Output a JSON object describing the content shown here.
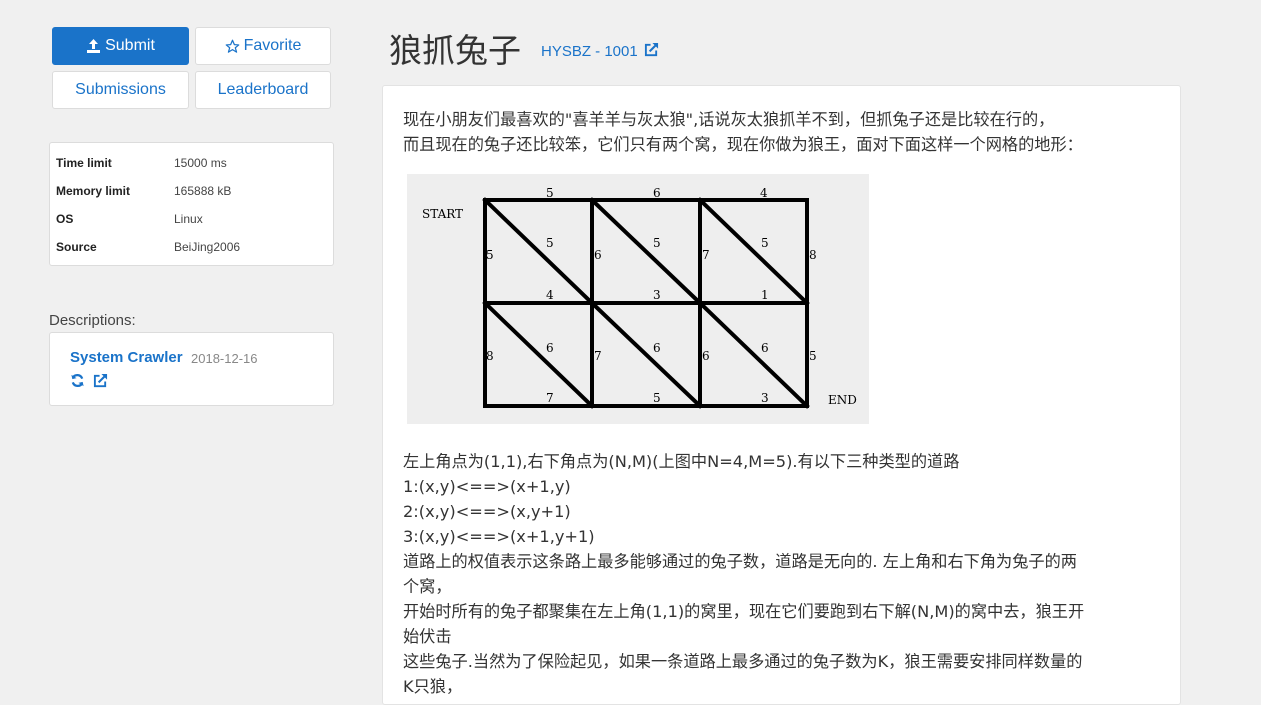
{
  "sidebar": {
    "buttons": {
      "submit": "Submit",
      "favorite": "Favorite",
      "submissions": "Submissions",
      "leaderboard": "Leaderboard"
    },
    "info": [
      {
        "key": "Time limit",
        "value": "15000 ms"
      },
      {
        "key": "Memory limit",
        "value": "165888 kB"
      },
      {
        "key": "OS",
        "value": "Linux"
      },
      {
        "key": "Source",
        "value": "BeiJing2006"
      }
    ],
    "descriptions_label": "Descriptions:",
    "description": {
      "author": "System Crawler",
      "date": "2018-12-16"
    }
  },
  "problem": {
    "title": "狼抓兔子",
    "link": "HYSBZ - 1001",
    "intro_lines": [
      "现在小朋友们最喜欢的\"喜羊羊与灰太狼\",话说灰太狼抓羊不到，但抓兔子还是比较在行的，",
      "而且现在的兔子还比较笨，它们只有两个窝，现在你做为狼王，面对下面这样一个网格的地形："
    ],
    "body_lines": [
      "左上角点为(1,1),右下角点为(N,M)(上图中N=4,M=5).有以下三种类型的道路",
      "1:(x,y)<==>(x+1,y)",
      "2:(x,y)<==>(x,y+1)",
      "3:(x,y)<==>(x+1,y+1)",
      "道路上的权值表示这条路上最多能够通过的兔子数，道路是无向的. 左上角和右下角为兔子的两",
      "个窝，",
      "开始时所有的兔子都聚集在左上角(1,1)的窝里，现在它们要跑到右下解(N,M)的窝中去，狼王开",
      "始伏击",
      "这些兔子.当然为了保险起见，如果一条道路上最多通过的兔子数为K，狼王需要安排同样数量的",
      "K只狼，"
    ],
    "figure": {
      "start_label": "START",
      "end_label": "END",
      "top_weights": [
        "5",
        "6",
        "4"
      ],
      "row1_left_weights": [
        "5",
        "6",
        "7",
        "8"
      ],
      "row1_diag_weights": [
        "5",
        "5",
        "5"
      ],
      "mid_weights": [
        "4",
        "3",
        "1"
      ],
      "row2_left_weights": [
        "8",
        "7",
        "6",
        "5"
      ],
      "row2_diag_weights": [
        "6",
        "6",
        "6"
      ],
      "bottom_weights": [
        "7",
        "5",
        "3"
      ]
    }
  },
  "colors": {
    "accent": "#1a73c9",
    "background": "#f0f0f0"
  }
}
